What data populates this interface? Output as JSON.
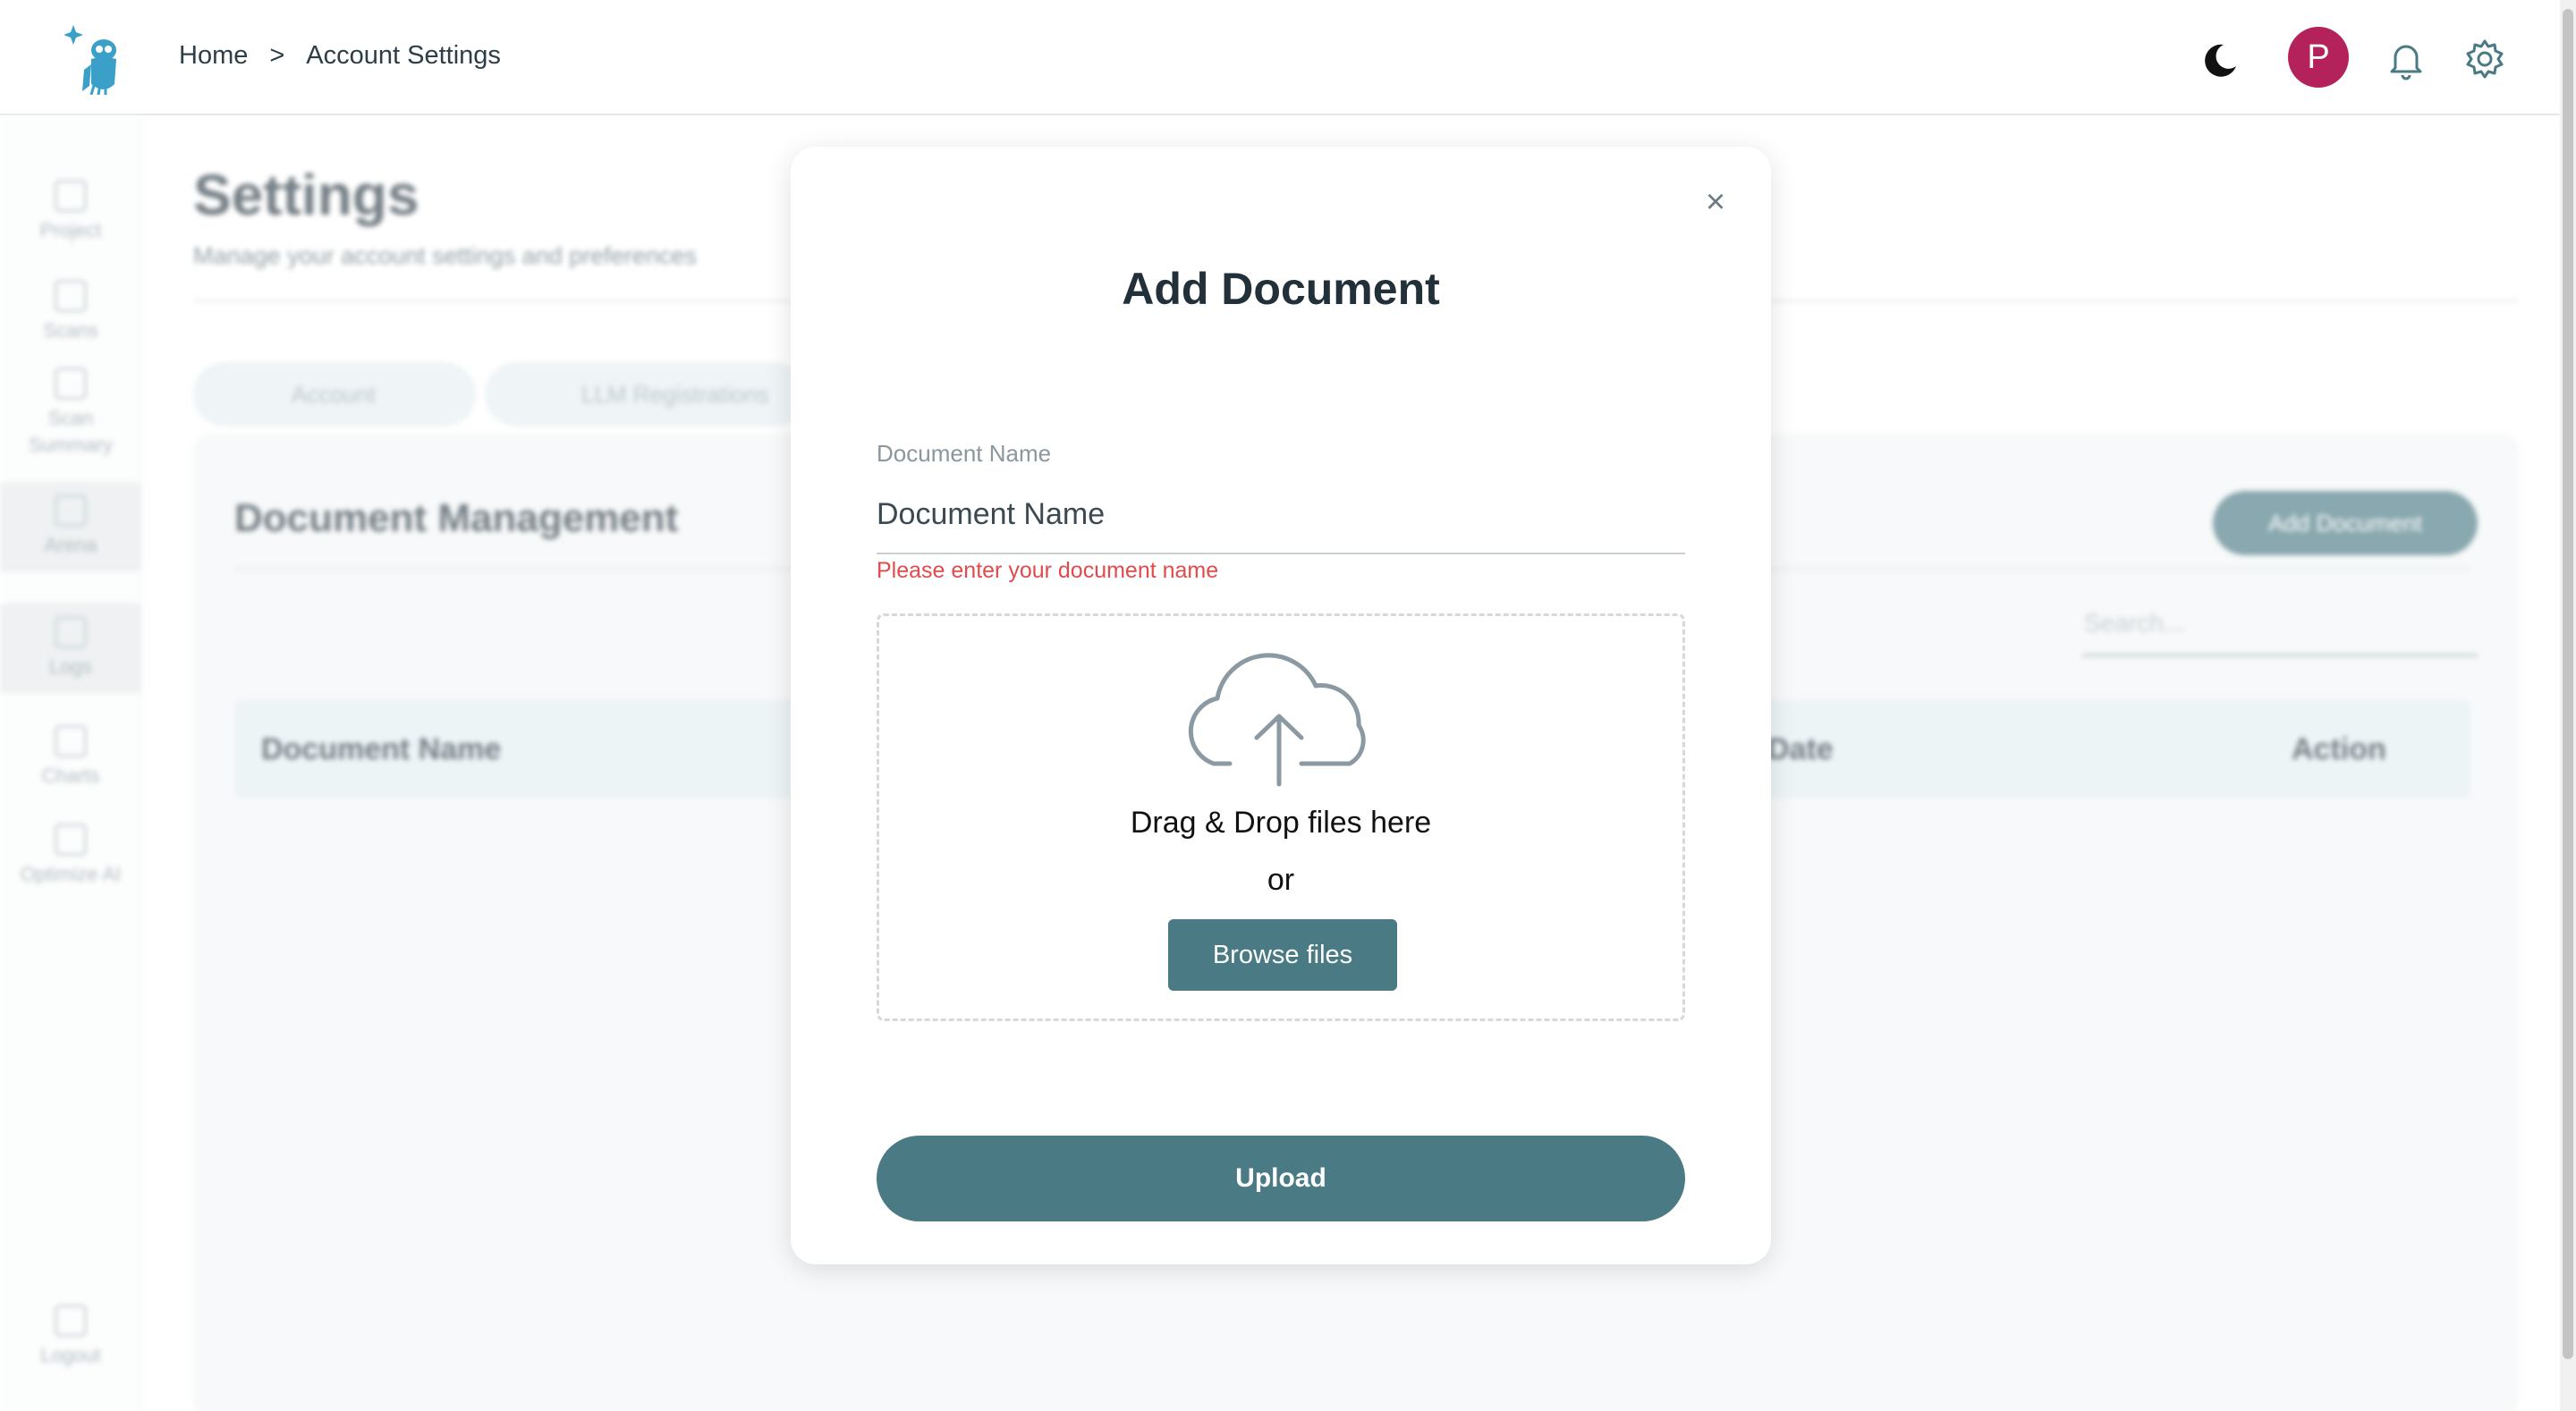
{
  "header": {
    "logo_icon": "owl-logo-icon",
    "breadcrumb": {
      "home": "Home",
      "separator": ">",
      "current": "Account Settings"
    },
    "avatar_initial": "P",
    "avatar_color": "#b3225a",
    "icons": [
      "moon-icon",
      "bell-icon",
      "gear-icon"
    ]
  },
  "sidebar": {
    "items": [
      {
        "label": "Project",
        "icon": "project-icon"
      },
      {
        "label": "Scans",
        "icon": "scans-icon"
      },
      {
        "label": "Scan Summary",
        "icon": "scan-summary-icon"
      },
      {
        "label": "Arena",
        "icon": "arena-icon"
      },
      {
        "label": "Logs",
        "icon": "logs-icon"
      },
      {
        "label": "Charts",
        "icon": "charts-icon"
      },
      {
        "label": "Optimize AI",
        "icon": "optimize-icon"
      }
    ],
    "logout": "Logout"
  },
  "page": {
    "title": "Settings",
    "subtitle": "Manage your account settings and preferences",
    "tabs": [
      {
        "label": "Account"
      },
      {
        "label": "LLM Registrations"
      }
    ],
    "panel": {
      "title": "Document Management",
      "add_button": "Add Document",
      "search_placeholder": "Search...",
      "columns": [
        "Document Name",
        "Date",
        "Action"
      ]
    }
  },
  "modal": {
    "title": "Add Document",
    "close": "×",
    "field_label": "Document Name",
    "field_placeholder": "Document Name",
    "error": "Please enter your document name",
    "drop_text": "Drag & Drop files here",
    "or_text": "or",
    "browse_button": "Browse files",
    "upload_button": "Upload"
  },
  "colors": {
    "primary": "#4a7a84",
    "error": "#e24b4b",
    "avatar": "#b3225a"
  }
}
